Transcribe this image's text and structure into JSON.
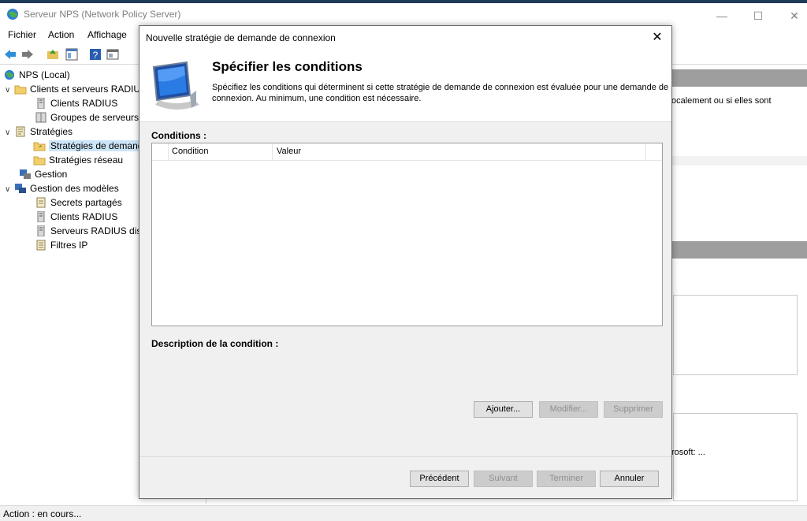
{
  "window": {
    "title": "Serveur NPS (Network Policy Server)",
    "controls": [
      "—",
      "☐",
      "✕"
    ]
  },
  "menu": [
    "Fichier",
    "Action",
    "Affichage"
  ],
  "tree": {
    "root": "NPS (Local)",
    "clients_group": "Clients et serveurs RADIU",
    "clients_radius": "Clients RADIUS",
    "groupes_serveurs": "Groupes de serveurs R",
    "strategies": "Stratégies",
    "strategies_demande": "Stratégies de demand",
    "strategies_reseau": "Stratégies réseau",
    "gestion": "Gestion",
    "gestion_modeles": "Gestion des modèles",
    "secrets": "Secrets partagés",
    "clients_radius_2": "Clients RADIUS",
    "serveurs_radius": "Serveurs RADIUS dista",
    "filtres_ip": "Filtres IP"
  },
  "right_panel": {
    "text1": "ocalement ou si elles sont",
    "text2": "rosoft: ..."
  },
  "status": "Action :  en cours...",
  "dialog": {
    "title": "Nouvelle stratégie de demande de connexion",
    "close": "✕",
    "heading": "Spécifier les conditions",
    "description": "Spécifiez les conditions qui déterminent si cette stratégie de demande de connexion est évaluée pour une demande de connexion. Au minimum, une condition est nécessaire.",
    "conditions_label": "Conditions :",
    "col_condition": "Condition",
    "col_valeur": "Valeur",
    "description_label": "Description de la condition :",
    "btn_ajouter": "Ajouter...",
    "btn_modifier": "Modifier...",
    "btn_supprimer": "Supprimer",
    "btn_precedent": "Précédent",
    "btn_suivant": "Suivant",
    "btn_terminer": "Terminer",
    "btn_annuler": "Annuler"
  }
}
